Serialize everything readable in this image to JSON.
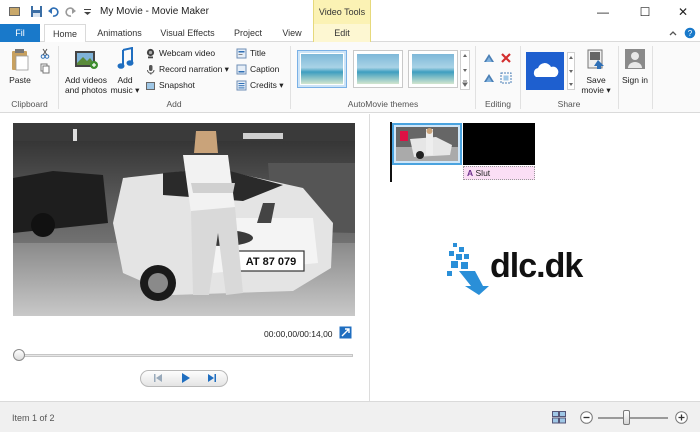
{
  "window": {
    "title": "My Movie - Movie Maker",
    "context_tab_header": "Video Tools",
    "controls": {
      "minimize": "—",
      "maximize": "☐",
      "close": "✕"
    }
  },
  "tabs": [
    {
      "label": "Fil"
    },
    {
      "label": "Home"
    },
    {
      "label": "Animations"
    },
    {
      "label": "Visual Effects"
    },
    {
      "label": "Project"
    },
    {
      "label": "View"
    },
    {
      "label": "Edit"
    }
  ],
  "ribbon": {
    "clipboard": {
      "group_label": "Clipboard",
      "paste": "Paste"
    },
    "add": {
      "group_label": "Add",
      "add_videos": "Add videos and photos",
      "add_music": "Add music",
      "webcam": "Webcam video",
      "record_narration": "Record narration",
      "snapshot": "Snapshot",
      "title": "Title",
      "caption": "Caption",
      "credits": "Credits"
    },
    "themes": {
      "group_label": "AutoMovie themes"
    },
    "editing": {
      "group_label": "Editing"
    },
    "share": {
      "group_label": "Share",
      "save_movie": "Save movie"
    },
    "signin": {
      "label": "Sign in"
    }
  },
  "preview": {
    "timecode": "00:00,00/00:14,00",
    "seek_progress": 0.0,
    "license_plate": "AT 87 079"
  },
  "storyboard": {
    "caption_text": "Slut",
    "logo_text": "dlc.dk"
  },
  "status": {
    "item_text": "Item 1 of 2",
    "zoom_level": 0.45
  },
  "colors": {
    "accent": "#1979ca",
    "context_tab": "#fbf2b4",
    "caption_pink": "#fbdff5",
    "onedrive_blue": "#1e5fcf",
    "logo_blue": "#2a8fd8"
  }
}
